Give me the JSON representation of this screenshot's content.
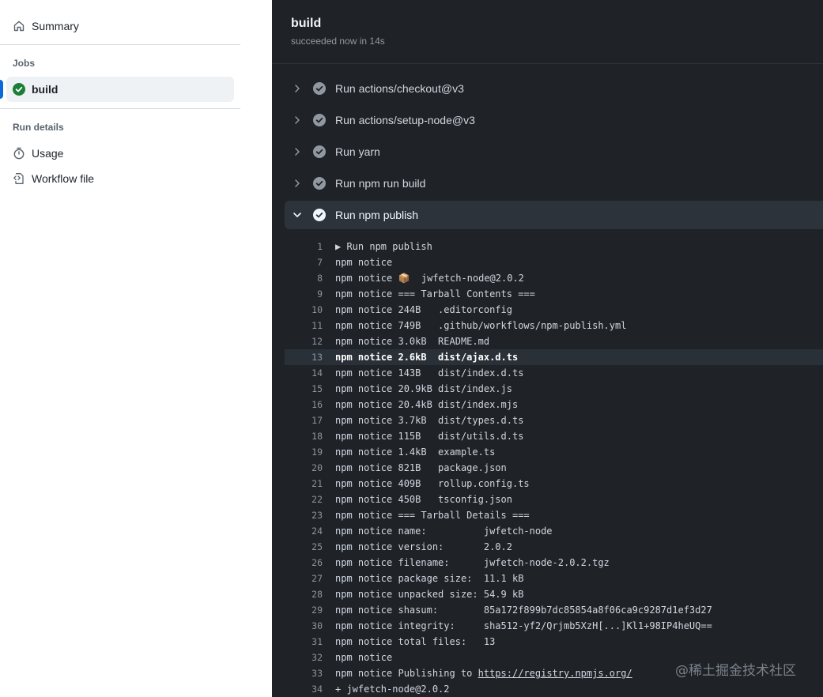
{
  "sidebar": {
    "summary_label": "Summary",
    "jobs_heading": "Jobs",
    "job_label": "build",
    "run_details_heading": "Run details",
    "usage_label": "Usage",
    "workflow_file_label": "Workflow file"
  },
  "job": {
    "title": "build",
    "status": "succeeded now in 14s"
  },
  "steps": [
    "Run actions/checkout@v3",
    "Run actions/setup-node@v3",
    "Run yarn",
    "Run npm run build",
    "Run npm publish"
  ],
  "log_lines": [
    {
      "n": "1",
      "t": "▶ Run npm publish"
    },
    {
      "n": "7",
      "t": "npm notice"
    },
    {
      "n": "8",
      "t": "npm notice 📦  jwfetch-node@2.0.2"
    },
    {
      "n": "9",
      "t": "npm notice === Tarball Contents ==="
    },
    {
      "n": "10",
      "t": "npm notice 244B   .editorconfig"
    },
    {
      "n": "11",
      "t": "npm notice 749B   .github/workflows/npm-publish.yml"
    },
    {
      "n": "12",
      "t": "npm notice 3.0kB  README.md"
    },
    {
      "n": "13",
      "t": "npm notice 2.6kB  dist/ajax.d.ts"
    },
    {
      "n": "14",
      "t": "npm notice 143B   dist/index.d.ts"
    },
    {
      "n": "15",
      "t": "npm notice 20.9kB dist/index.js"
    },
    {
      "n": "16",
      "t": "npm notice 20.4kB dist/index.mjs"
    },
    {
      "n": "17",
      "t": "npm notice 3.7kB  dist/types.d.ts"
    },
    {
      "n": "18",
      "t": "npm notice 115B   dist/utils.d.ts"
    },
    {
      "n": "19",
      "t": "npm notice 1.4kB  example.ts"
    },
    {
      "n": "20",
      "t": "npm notice 821B   package.json"
    },
    {
      "n": "21",
      "t": "npm notice 409B   rollup.config.ts"
    },
    {
      "n": "22",
      "t": "npm notice 450B   tsconfig.json"
    },
    {
      "n": "23",
      "t": "npm notice === Tarball Details ==="
    },
    {
      "n": "24",
      "t": "npm notice name:          jwfetch-node"
    },
    {
      "n": "25",
      "t": "npm notice version:       2.0.2"
    },
    {
      "n": "26",
      "t": "npm notice filename:      jwfetch-node-2.0.2.tgz"
    },
    {
      "n": "27",
      "t": "npm notice package size:  11.1 kB"
    },
    {
      "n": "28",
      "t": "npm notice unpacked size: 54.9 kB"
    },
    {
      "n": "29",
      "t": "npm notice shasum:        85a172f899b7dc85854a8f06ca9c9287d1ef3d27"
    },
    {
      "n": "30",
      "t": "npm notice integrity:     sha512-yf2/Qrjmb5XzH[...]Kl1+98IP4heUQ=="
    },
    {
      "n": "31",
      "t": "npm notice total files:   13"
    },
    {
      "n": "32",
      "t": "npm notice"
    },
    {
      "n": "33",
      "t": "npm notice Publishing to ",
      "link": "https://registry.npmjs.org/"
    },
    {
      "n": "34",
      "t": "+ jwfetch-node@2.0.2"
    }
  ],
  "highlighted_line": "13",
  "watermark": "@稀土掘金技术社区",
  "colors": {
    "success_green": "#1a7f37",
    "active_accent": "#0969da",
    "log_background": "#1f2328"
  }
}
